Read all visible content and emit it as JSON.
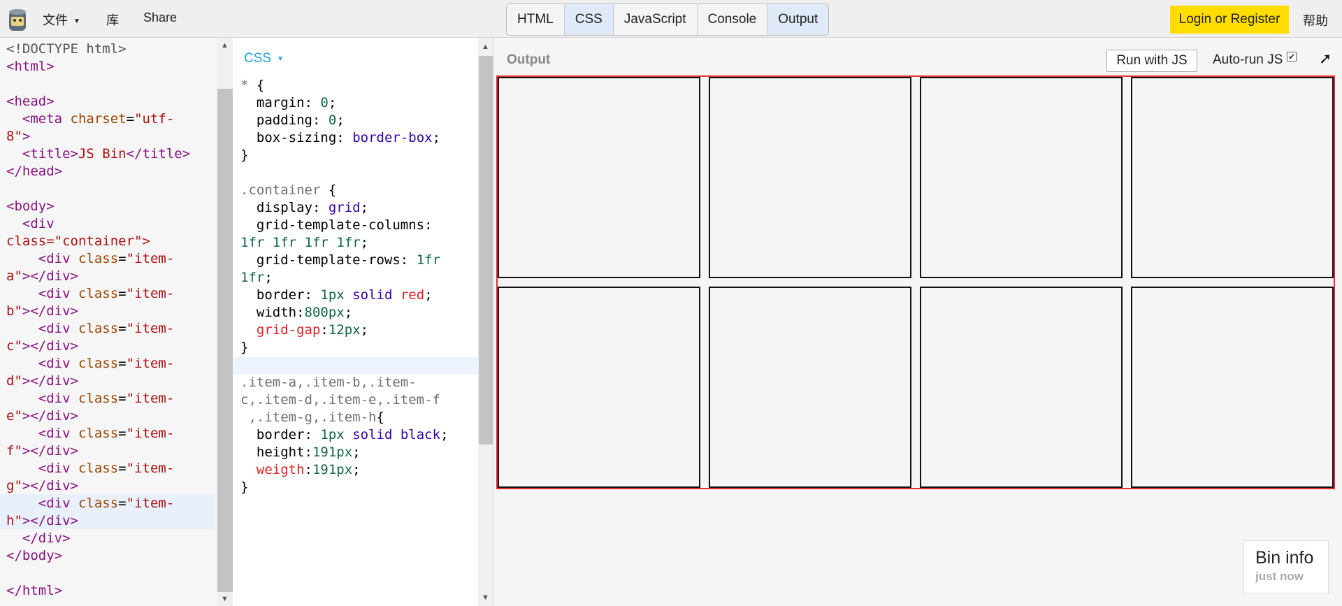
{
  "toolbar": {
    "menu": [
      {
        "label": "文件",
        "has_dropdown": true
      },
      {
        "label": "库",
        "has_dropdown": false
      },
      {
        "label": "Share",
        "has_dropdown": false
      }
    ],
    "panel_tabs": [
      {
        "label": "HTML",
        "active": false
      },
      {
        "label": "CSS",
        "active": true
      },
      {
        "label": "JavaScript",
        "active": false
      },
      {
        "label": "Console",
        "active": false
      },
      {
        "label": "Output",
        "active": true
      }
    ],
    "login_label": "Login or Register",
    "help_label": "帮助",
    "colors": {
      "login_bg": "#ffdd00",
      "active_tab_bg": "#dfe9f7"
    }
  },
  "html_editor": {
    "lines": [
      "<!DOCTYPE html>",
      "<html>",
      "",
      "<head>",
      "  <meta charset=\"utf-",
      "8\">",
      "  <title>JS Bin</title>",
      "</head>",
      "",
      "<body>",
      "  <div",
      "class=\"container\">",
      "    <div class=\"item-",
      "a\"></div>",
      "    <div class=\"item-",
      "b\"></div>",
      "    <div class=\"item-",
      "c\"></div>",
      "    <div class=\"item-",
      "d\"></div>",
      "    <div class=\"item-",
      "e\"></div>",
      "    <div class=\"item-",
      "f\"></div>",
      "    <div class=\"item-",
      "g\"></div>",
      "    <div class=\"item-",
      "h\"></div>",
      "  </div>",
      "</body>",
      "",
      "</html>"
    ]
  },
  "css_editor": {
    "label": "CSS",
    "lines": [
      "* {",
      "  margin: 0;",
      "  padding: 0;",
      "  box-sizing: border-box;",
      "}",
      "",
      ".container {",
      "  display: grid;",
      "  grid-template-columns:",
      "1fr 1fr 1fr 1fr;",
      "  grid-template-rows: 1fr",
      "1fr;",
      "  border: 1px solid red;",
      "  width:800px;",
      "  grid-gap:12px;",
      "}",
      "",
      ".item-a,.item-b,.item-",
      "c,.item-d,.item-e,.item-f",
      " ,.item-g,.item-h{",
      "  border: 1px solid black;",
      "  height:191px;",
      "  weigth:191px;",
      "}"
    ]
  },
  "output": {
    "label": "Output",
    "run_label": "Run with JS",
    "autorun_label": "Auto-run JS",
    "autorun_checked": true,
    "popout_icon": "arrow-up-right-icon",
    "grid": {
      "columns": 4,
      "rows": 2,
      "item_count": 8
    },
    "colors": {
      "container_border": "#e03030",
      "item_border": "#111111"
    },
    "bin_info": {
      "title": "Bin info",
      "time": "just now"
    }
  }
}
